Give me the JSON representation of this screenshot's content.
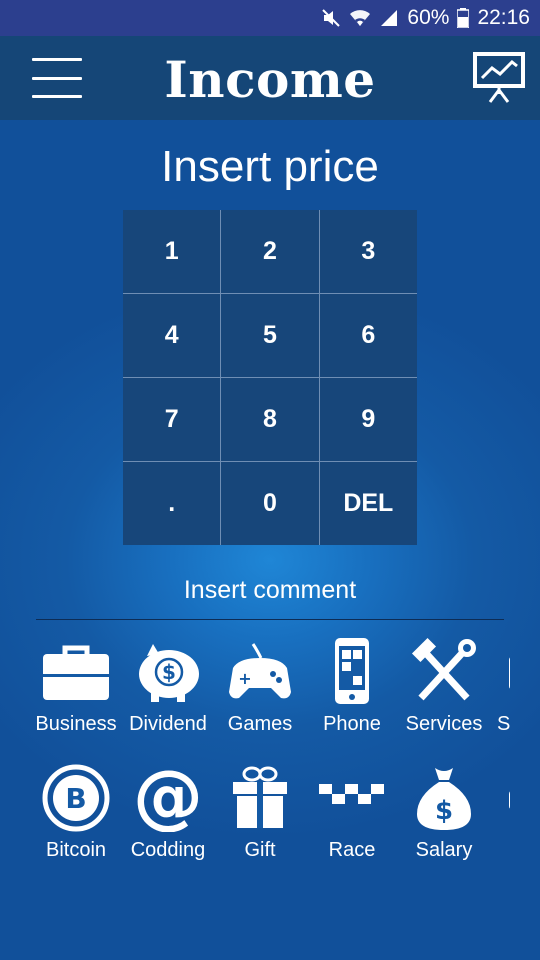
{
  "status_bar": {
    "battery": "60%",
    "time": "22:16"
  },
  "header": {
    "title": "Income",
    "menu_icon": "hamburger-menu-icon",
    "stats_icon": "chart-presentation-icon"
  },
  "price": {
    "title": "Insert price"
  },
  "keypad": {
    "keys": [
      "1",
      "2",
      "3",
      "4",
      "5",
      "6",
      "7",
      "8",
      "9",
      ".",
      "0",
      "DEL"
    ]
  },
  "comment": {
    "placeholder": "Insert comment"
  },
  "categories": {
    "row1": [
      {
        "label": "Business",
        "icon": "briefcase-icon"
      },
      {
        "label": "Dividend",
        "icon": "piggy-bank-icon"
      },
      {
        "label": "Games",
        "icon": "gamepad-icon"
      },
      {
        "label": "Phone",
        "icon": "phone-icon"
      },
      {
        "label": "Services",
        "icon": "tools-icon"
      },
      {
        "label": "S",
        "icon": "partial-icon"
      }
    ],
    "row2": [
      {
        "label": "Bitcoin",
        "icon": "bitcoin-icon"
      },
      {
        "label": "Codding",
        "icon": "at-sign-icon"
      },
      {
        "label": "Gift",
        "icon": "gift-icon"
      },
      {
        "label": "Race",
        "icon": "checkered-flag-icon"
      },
      {
        "label": "Salary",
        "icon": "money-bag-icon"
      }
    ]
  },
  "colors": {
    "status_bar": "#2c3f8e",
    "app_bar": "#154677",
    "background": "#145aa5",
    "key": "#17467a"
  }
}
